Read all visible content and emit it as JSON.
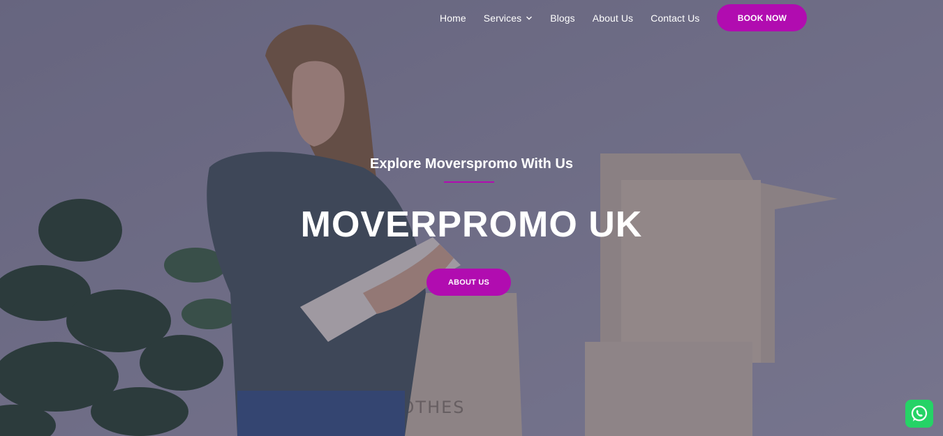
{
  "nav": {
    "items": [
      {
        "label": "Home"
      },
      {
        "label": "Services"
      },
      {
        "label": "Blogs"
      },
      {
        "label": "About Us"
      },
      {
        "label": "Contact Us"
      }
    ],
    "book_label": "BOOK NOW"
  },
  "hero": {
    "subtitle": "Explore Moverspromo With Us",
    "title": "MOVERPROMO UK",
    "cta_label": "ABOUT US"
  },
  "colors": {
    "accent": "#b10cb0",
    "whatsapp": "#25d366",
    "text": "#ffffff"
  },
  "icons": {
    "services_dropdown": "chevron-down-icon",
    "chat": "whatsapp-icon"
  }
}
